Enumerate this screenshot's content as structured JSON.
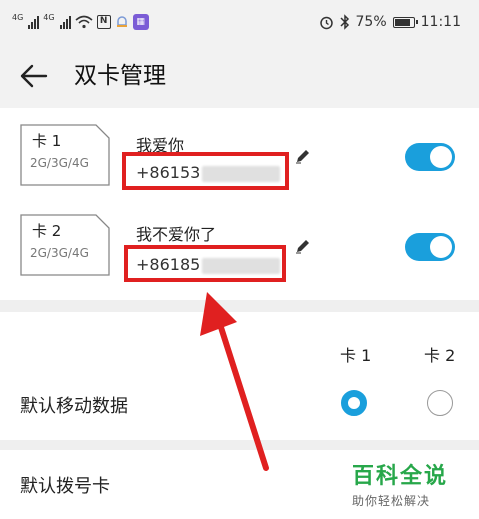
{
  "status_bar": {
    "network_1": "4G",
    "network_2": "4G",
    "icon_n": "N",
    "battery_percent": "75%",
    "time": "11:11",
    "icons": [
      "signal-icon",
      "signal-icon",
      "wifi-icon",
      "nfc-icon",
      "notification-icon",
      "app-icon",
      "alarm-icon",
      "bluetooth-icon",
      "battery-icon"
    ]
  },
  "header": {
    "title": "双卡管理",
    "back_icon": "back-arrow-icon"
  },
  "cards": [
    {
      "sim_label": "卡 1",
      "sim_network": "2G/3G/4G",
      "name": "我爱你",
      "number_prefix": "+86153",
      "enabled": true
    },
    {
      "sim_label": "卡 2",
      "sim_network": "2G/3G/4G",
      "name": "我不爱你了",
      "number_prefix": "+86185",
      "enabled": true
    }
  ],
  "default_data": {
    "col_card1": "卡 1",
    "col_card2": "卡 2",
    "label": "默认移动数据",
    "selected": "卡 1"
  },
  "default_dial": {
    "label": "默认拨号卡"
  },
  "watermark": {
    "title": "百科全说",
    "subtitle": "助你轻松解决"
  },
  "colors": {
    "accent": "#1a9fdc",
    "annotation": "#e02020",
    "watermark": "#27a74a"
  }
}
